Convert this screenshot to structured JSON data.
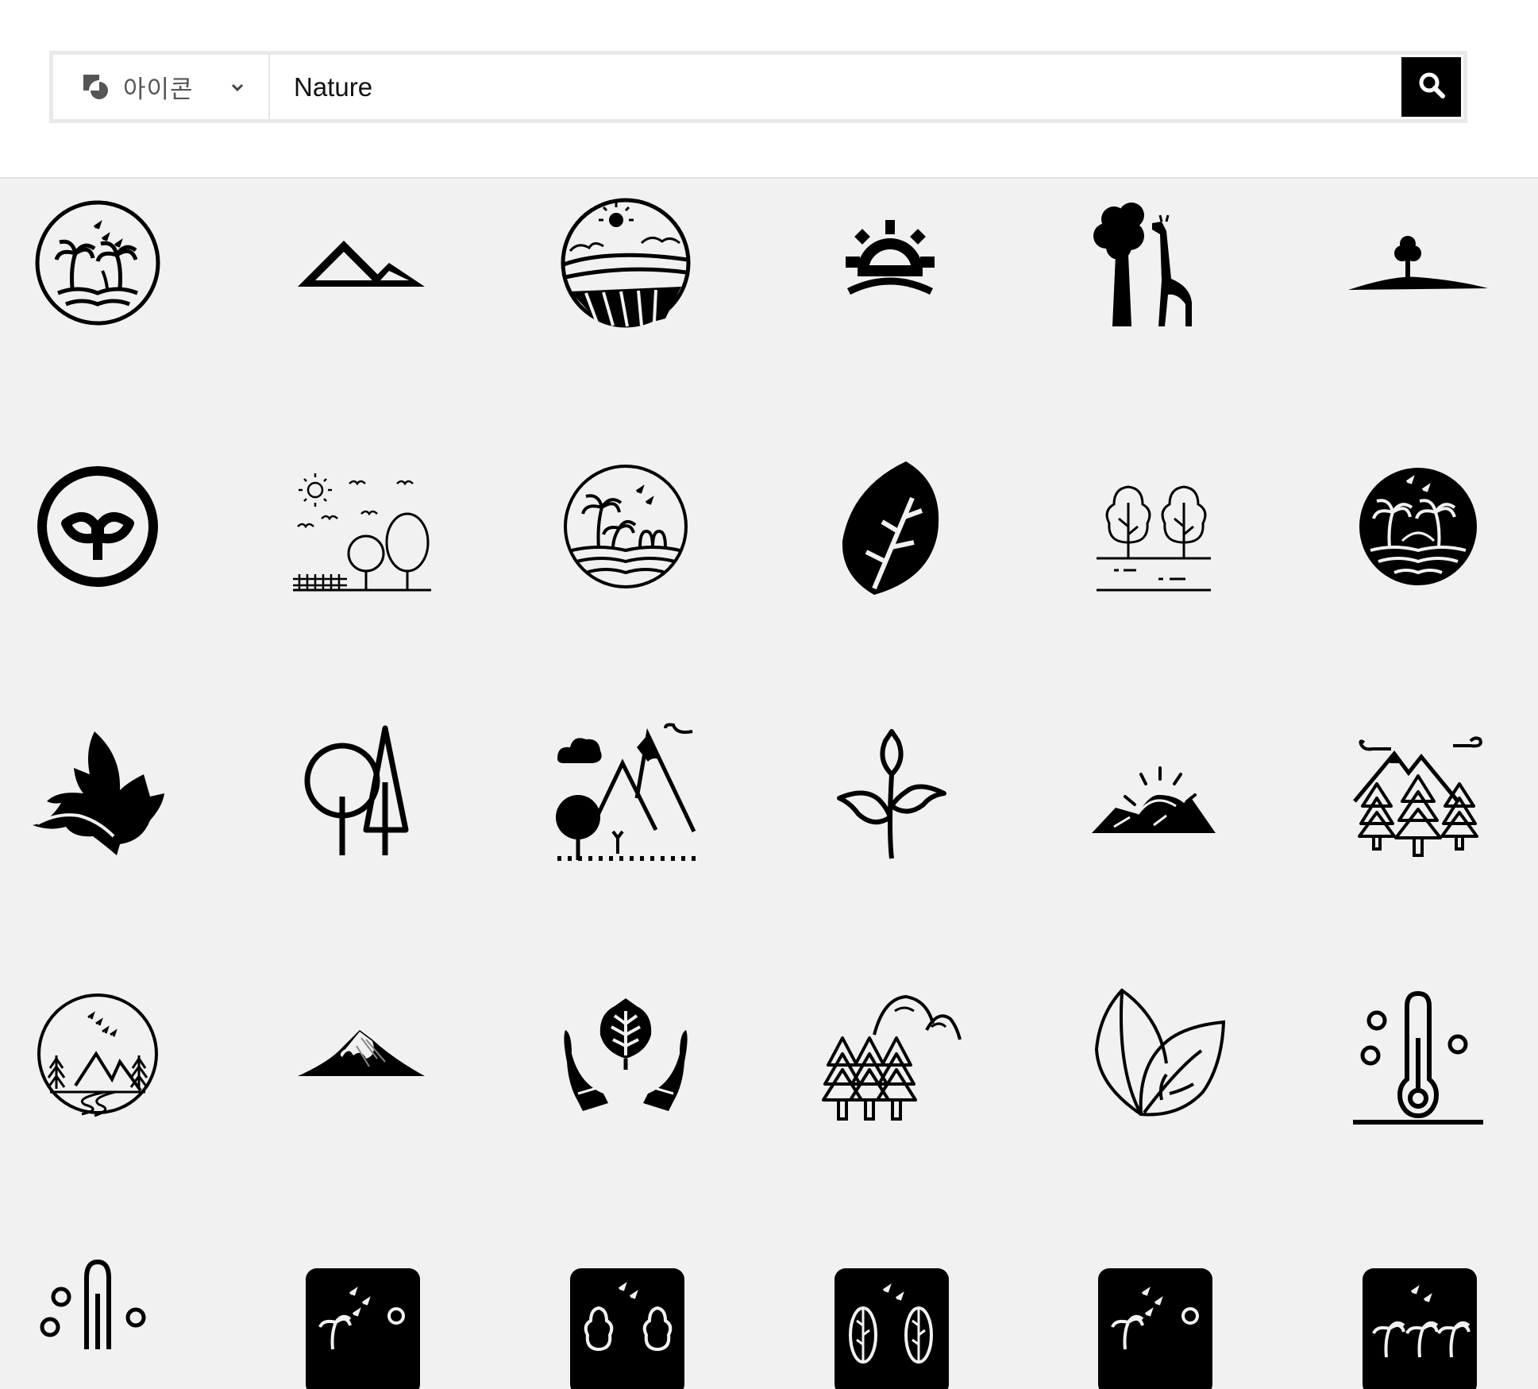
{
  "search": {
    "type_label": "아이콘",
    "query": "Nature"
  },
  "icons": [
    "palm-island-circle-icon",
    "mountains-icon",
    "farmland-landscape-circle-icon",
    "sunrise-icon",
    "tree-giraffe-icon",
    "hill-tree-icon",
    "sprout-circle-icon",
    "park-trees-birds-icon",
    "tropical-beach-circle-icon",
    "leaf-icon",
    "trees-outline-icon",
    "palm-island-dark-circle-icon",
    "bird-leaf-icon",
    "trees-simple-icon",
    "mountain-landscape-icon",
    "plant-sprout-icon",
    "sunset-mountains-icon",
    "forest-mountains-icon",
    "forest-river-circle-icon",
    "snow-mountain-icon",
    "hands-leaf-icon",
    "pine-forest-hills-icon",
    "two-leaves-icon",
    "thermometer-icon",
    "thermometer-partial-icon",
    "palm-moon-tile-icon",
    "trees-tile-icon",
    "leaves-tile-icon",
    "palm-moon-tile-2-icon",
    "palm-trees-tile-icon"
  ]
}
